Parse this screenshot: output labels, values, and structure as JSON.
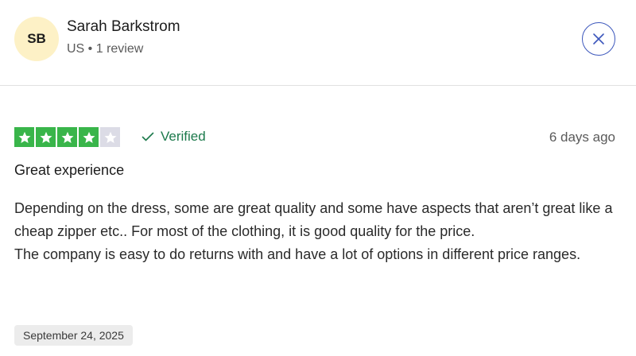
{
  "reviewer": {
    "initials": "SB",
    "name": "Sarah Barkstrom",
    "meta": "US • 1 review"
  },
  "close": {
    "icon": "close-icon"
  },
  "review": {
    "rating": 4,
    "max_rating": 5,
    "verified_label": "Verified",
    "posted_ago": "6 days ago",
    "title": "Great experience",
    "body_lines": [
      "Depending on the dress, some are great quality and some have aspects that aren’t great like a cheap zipper etc.. For most of the clothing, it is good quality for the price.",
      "The company is easy to do returns with and have a lot of options in different price ranges."
    ],
    "date": "September 24, 2025"
  },
  "colors": {
    "star_filled": "#39b54a",
    "star_empty": "#dcdce6",
    "verified": "#1d7a4c",
    "close_accent": "#3c57bc",
    "avatar_bg": "#fdf1c6"
  }
}
